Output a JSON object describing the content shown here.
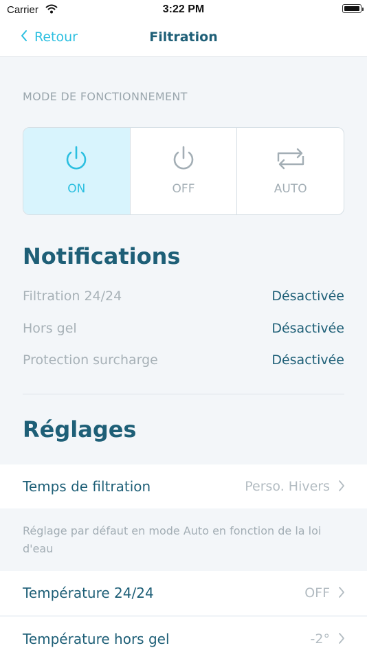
{
  "status_bar": {
    "carrier": "Carrier",
    "time": "3:22 PM"
  },
  "nav": {
    "back_label": "Retour",
    "title": "Filtration"
  },
  "mode": {
    "section_label": "MODE DE FONCTIONNEMENT",
    "options": [
      {
        "label": "ON",
        "icon": "power-icon",
        "active": true
      },
      {
        "label": "OFF",
        "icon": "power-icon",
        "active": false
      },
      {
        "label": "AUTO",
        "icon": "repeat-icon",
        "active": false
      }
    ]
  },
  "notifications": {
    "title": "Notifications",
    "rows": [
      {
        "label": "Filtration 24/24",
        "value": "Désactivée"
      },
      {
        "label": "Hors gel",
        "value": "Désactivée"
      },
      {
        "label": "Protection surcharge",
        "value": "Désactivée"
      }
    ]
  },
  "settings": {
    "title": "Réglages",
    "filtration_time": {
      "label": "Temps de filtration",
      "value": "Perso. Hivers"
    },
    "note": "Réglage par défaut en mode Auto en fonction de la loi d'eau",
    "temp_24": {
      "label": "Température 24/24",
      "value": "OFF"
    },
    "temp_frost": {
      "label": "Température hors gel",
      "value": "-2°"
    }
  },
  "colors": {
    "accent": "#2bbfe0",
    "primary_text": "#1e5f77",
    "secondary_text": "#a7b1b7",
    "active_bg": "#d8f4fd"
  }
}
